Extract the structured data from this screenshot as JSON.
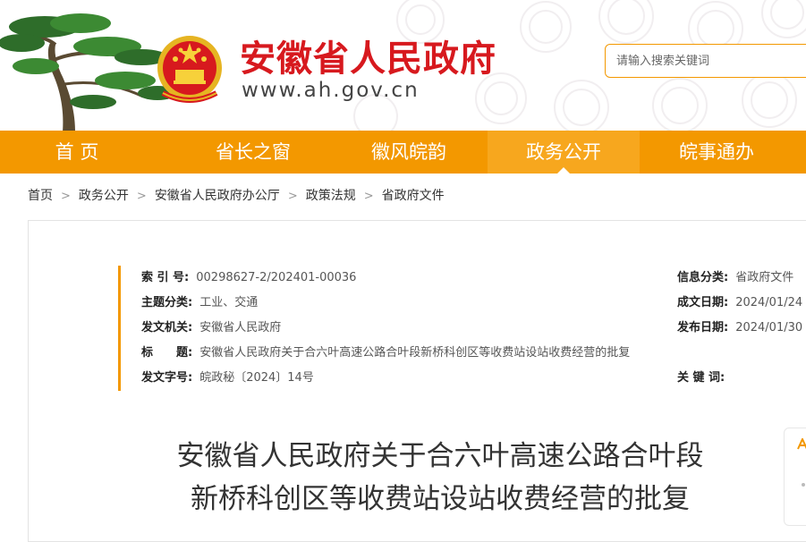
{
  "header": {
    "site_name": "安徽省人民政府",
    "site_url": "www.ah.gov.cn",
    "search_placeholder": "请输入搜索关键词",
    "brand_color": "#d7191e",
    "accent_color": "#f39800",
    "pine_icon": "huangshan-pine-icon",
    "emblem_icon": "national-emblem-icon"
  },
  "nav": {
    "items": [
      {
        "label": "首 页"
      },
      {
        "label": "省长之窗"
      },
      {
        "label": "徽风皖韵"
      },
      {
        "label": "政务公开",
        "active": true
      },
      {
        "label": "皖事通办"
      }
    ]
  },
  "breadcrumb": {
    "items": [
      "首页",
      "政务公开",
      "安徽省人民政府办公厅",
      "政策法规",
      "省政府文件"
    ],
    "separator": ">"
  },
  "meta": {
    "index_label": "索 引 号:",
    "index_value": "00298627-2/202401-00036",
    "topic_label": "主题分类:",
    "topic_value": "工业、交通",
    "issuer_label": "发文机关:",
    "issuer_value": "安徽省人民政府",
    "title_label": "标  题:",
    "title_value": "安徽省人民政府关于合六叶高速公路合叶段新桥科创区等收费站设站收费经营的批复",
    "docno_label": "发文字号:",
    "docno_value": "皖政秘〔2024〕14号",
    "category_label": "信息分类:",
    "category_value": "省政府文件",
    "created_label": "成文日期:",
    "created_value": "2024/01/24",
    "published_label": "发布日期:",
    "published_value": "2024/01/30",
    "keywords_label": "关 键 词:",
    "keywords_value": ""
  },
  "document": {
    "title_line1": "安徽省人民政府关于合六叶高速公路合叶段",
    "title_line2": "新桥科创区等收费站设站收费经营的批复"
  },
  "side": {
    "icon": "font-size-icon"
  }
}
